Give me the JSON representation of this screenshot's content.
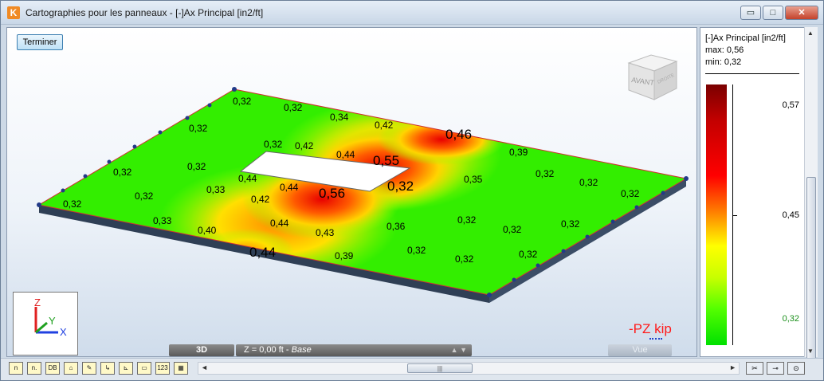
{
  "window": {
    "title": "Cartographies pour les panneaux - [-]Ax Principal [in2/ft]",
    "app_icon_letter": "K",
    "buttons": {
      "minimize": "▭",
      "maximize": "□",
      "close": "✕"
    }
  },
  "viewport": {
    "terminer_label": "Terminer",
    "viewcube_front": "AVANT",
    "viewcube_right": "DROITE",
    "axes": {
      "z": "Z",
      "y": "Y",
      "x": "X"
    },
    "load_label": "-PZ kip",
    "view_mode_label": "3D",
    "z_level_value": "Z = 0,00 ft",
    "z_level_story": "Base",
    "view_button_label": "Vue"
  },
  "plate_values": [
    {
      "text": "0,32",
      "big": false
    },
    {
      "text": "0,32",
      "big": false
    },
    {
      "text": "0,34",
      "big": false
    },
    {
      "text": "0,42",
      "big": false
    },
    {
      "text": "0,46",
      "big": true
    },
    {
      "text": "0,32",
      "big": false
    },
    {
      "text": "0,32",
      "big": false
    },
    {
      "text": "0,42",
      "big": false
    },
    {
      "text": "0,44",
      "big": false
    },
    {
      "text": "0,55",
      "big": true
    },
    {
      "text": "0,39",
      "big": false
    },
    {
      "text": "0,32",
      "big": false
    },
    {
      "text": "0,32",
      "big": false
    },
    {
      "text": "0,44",
      "big": false
    },
    {
      "text": "0,44",
      "big": false
    },
    {
      "text": "0,56",
      "big": true
    },
    {
      "text": "0,32",
      "big": true
    },
    {
      "text": "0,35",
      "big": false
    },
    {
      "text": "0,32",
      "big": false
    },
    {
      "text": "0,32",
      "big": false
    },
    {
      "text": "0,32",
      "big": false
    },
    {
      "text": "0,33",
      "big": false
    },
    {
      "text": "0,32",
      "big": false
    },
    {
      "text": "0,42",
      "big": false
    },
    {
      "text": "0,32",
      "big": false
    },
    {
      "text": "0,33",
      "big": false
    },
    {
      "text": "0,44",
      "big": false
    },
    {
      "text": "0,36",
      "big": false
    },
    {
      "text": "0,32",
      "big": false
    },
    {
      "text": "0,32",
      "big": false
    },
    {
      "text": "0,40",
      "big": false
    },
    {
      "text": "0,43",
      "big": false
    },
    {
      "text": "0,32",
      "big": false
    },
    {
      "text": "0,44",
      "big": true
    },
    {
      "text": "0,39",
      "big": false
    },
    {
      "text": "0,32",
      "big": false
    },
    {
      "text": "0,32",
      "big": false
    },
    {
      "text": "0,32",
      "big": false
    }
  ],
  "legend": {
    "title": "[-]Ax Principal [in2/ft]",
    "max_line": "max: 0,56",
    "min_line": "min: 0,32",
    "values": [
      "0,57",
      "0,45",
      "0,32"
    ],
    "colors": {
      "high": "#7a0000",
      "mid": "#ffff00",
      "low": "#00e000"
    }
  },
  "toolbar": {
    "tools": [
      "n",
      "n.",
      "DB",
      "⌂",
      "✎",
      "↳",
      "⊾",
      "▭",
      "123",
      "▦"
    ],
    "right_tools": [
      "✂",
      "⊸",
      "⊙"
    ]
  }
}
